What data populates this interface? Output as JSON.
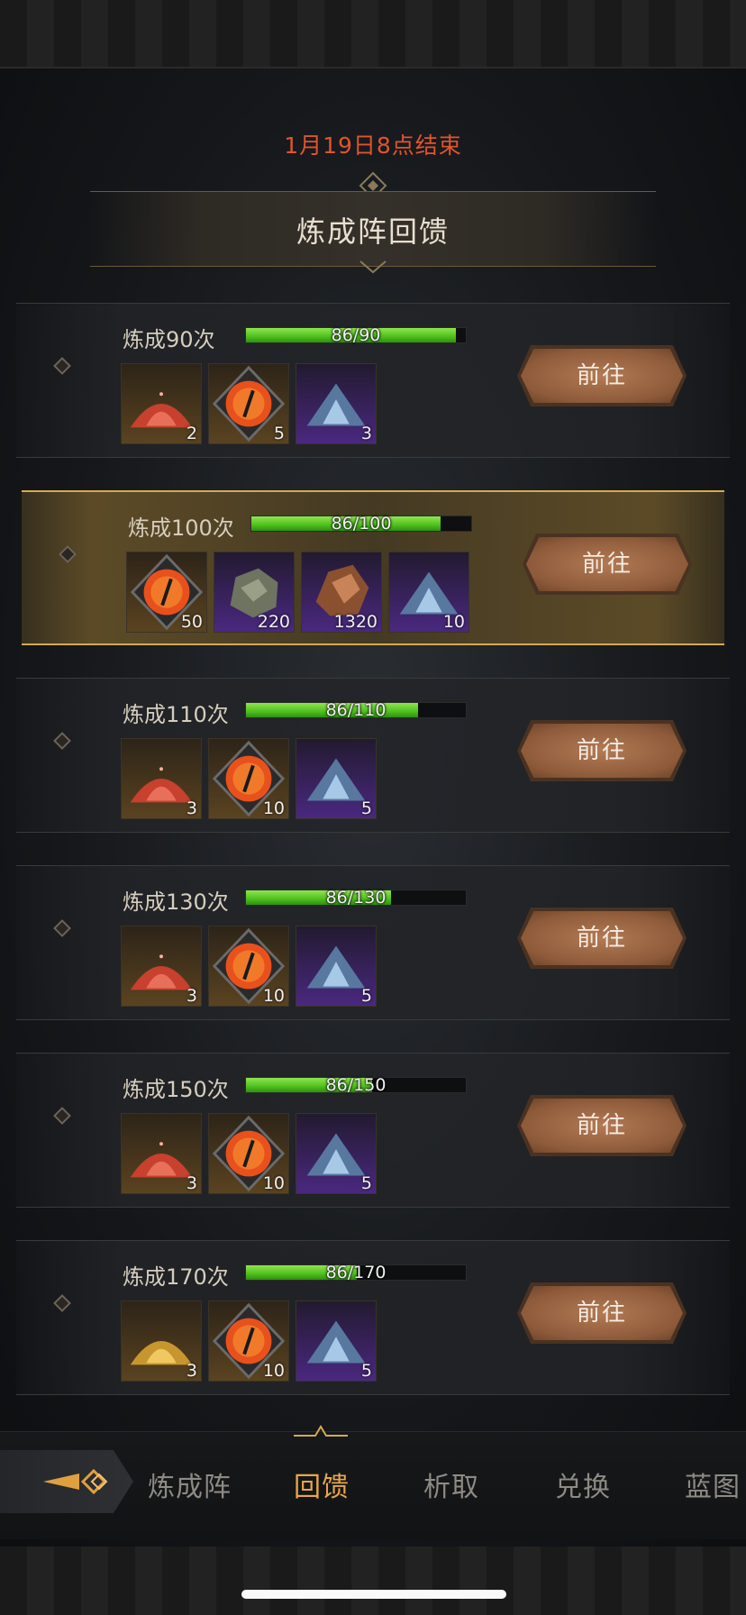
{
  "header": {
    "end_time": "1月19日8点结束",
    "title": "炼成阵回馈"
  },
  "rows": [
    {
      "label": "炼成90次",
      "progress_text": "86/90",
      "progress_fraction": 0.9556,
      "button": "前往",
      "items": [
        {
          "icon": "red-powder-icon",
          "frame": "gold",
          "count": "2"
        },
        {
          "icon": "fire-eye-orb-icon",
          "frame": "gold",
          "count": "5"
        },
        {
          "icon": "blue-crystal-powder-icon",
          "frame": "purple",
          "count": "3"
        }
      ]
    },
    {
      "label": "炼成100次",
      "progress_text": "86/100",
      "progress_fraction": 0.86,
      "button": "前往",
      "items": [
        {
          "icon": "fire-eye-orb-icon",
          "frame": "gold",
          "count": "50"
        },
        {
          "icon": "gray-ore-icon",
          "frame": "purple",
          "count": "220"
        },
        {
          "icon": "brown-ore-icon",
          "frame": "purple",
          "count": "1320"
        },
        {
          "icon": "blue-crystal-powder-icon",
          "frame": "purple",
          "count": "10"
        }
      ]
    },
    {
      "label": "炼成110次",
      "progress_text": "86/110",
      "progress_fraction": 0.7818,
      "button": "前往",
      "items": [
        {
          "icon": "red-powder-icon",
          "frame": "gold",
          "count": "3"
        },
        {
          "icon": "fire-eye-orb-icon",
          "frame": "gold",
          "count": "10"
        },
        {
          "icon": "blue-crystal-powder-icon",
          "frame": "purple",
          "count": "5"
        }
      ]
    },
    {
      "label": "炼成130次",
      "progress_text": "86/130",
      "progress_fraction": 0.6615,
      "button": "前往",
      "items": [
        {
          "icon": "red-powder-icon",
          "frame": "gold",
          "count": "3"
        },
        {
          "icon": "fire-eye-orb-icon",
          "frame": "gold",
          "count": "10"
        },
        {
          "icon": "blue-crystal-powder-icon",
          "frame": "purple",
          "count": "5"
        }
      ]
    },
    {
      "label": "炼成150次",
      "progress_text": "86/150",
      "progress_fraction": 0.5733,
      "button": "前往",
      "items": [
        {
          "icon": "red-powder-icon",
          "frame": "gold",
          "count": "3"
        },
        {
          "icon": "fire-eye-orb-icon",
          "frame": "gold",
          "count": "10"
        },
        {
          "icon": "blue-crystal-powder-icon",
          "frame": "purple",
          "count": "5"
        }
      ]
    },
    {
      "label": "炼成170次",
      "progress_text": "86/170",
      "progress_fraction": 0.5059,
      "button": "前往",
      "items": [
        {
          "icon": "gold-powder-icon",
          "frame": "gold",
          "count": "3"
        },
        {
          "icon": "fire-eye-orb-icon",
          "frame": "gold",
          "count": "10"
        },
        {
          "icon": "blue-crystal-powder-icon",
          "frame": "purple",
          "count": "5"
        }
      ]
    }
  ],
  "bottom_nav": {
    "back_icon": "diamond-arrow-back-icon",
    "tabs": [
      {
        "label": "炼成阵",
        "active": false
      },
      {
        "label": "回馈",
        "active": true
      },
      {
        "label": "析取",
        "active": false
      },
      {
        "label": "兑换",
        "active": false
      },
      {
        "label": "蓝图",
        "active": false
      }
    ]
  },
  "colors": {
    "end_time": "#e0542c",
    "progress": "#4fbf1e",
    "active_tab": "#e8a64a",
    "button": "#8d5a3a"
  }
}
